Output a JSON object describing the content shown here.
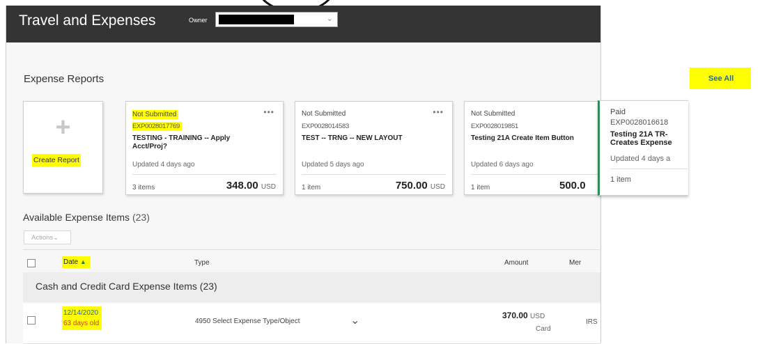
{
  "header": {
    "title": "Travel and Expenses",
    "owner_label": "Owner",
    "owner_chevron": "⌄"
  },
  "expense_reports": {
    "title": "Expense Reports",
    "see_all": "See All",
    "create_plus": "+",
    "create_label": "Create Report",
    "cards": [
      {
        "status": "Not Submitted",
        "number": "EXP0028017769",
        "name": "TESTING - TRAINING -- Apply Acct/Proj?",
        "updated": "Updated 4 days ago",
        "items": "3 items",
        "amount": "348.00",
        "currency": "USD",
        "menu": "•••"
      },
      {
        "status": "Not Submitted",
        "number": "EXP0028014583",
        "name": "TEST -- TRNG -- NEW LAYOUT",
        "updated": "Updated 5 days ago",
        "items": "1 item",
        "amount": "750.00",
        "currency": "USD",
        "menu": "•••"
      },
      {
        "status": "Not Submitted",
        "number": "EXP0028019851",
        "name": "Testing 21A Create Item Button",
        "updated": "Updated 6 days ago",
        "items": "1 item",
        "amount": "500.0"
      },
      {
        "status": "Paid",
        "number": "EXP0028016618",
        "name": "Testing 21A TR-Creates Expense",
        "updated": "Updated 4 days a",
        "items": "1 item"
      }
    ]
  },
  "available_items": {
    "title": "Available Expense Items",
    "count": "(23)",
    "actions_label": "Actions",
    "actions_chevron": "⌄",
    "columns": {
      "date": "Date",
      "sort_icon": "▲",
      "type": "Type",
      "amount": "Amount",
      "merchant": "Mer"
    },
    "group": {
      "label": "Cash and Credit Card Expense Items",
      "count": "(23)"
    },
    "rows": [
      {
        "date": "12/14/2020",
        "age": "63 days old",
        "type": "4950 Select Expense Type/Object",
        "expand_icon": "⌄",
        "amount": "370.00",
        "currency": "USD",
        "payment": "Card",
        "merchant": "IRS"
      }
    ]
  },
  "colors": {
    "header_bg": "#343434",
    "highlight": "#ffff00",
    "paid_accent": "#2e8b57",
    "link_blue": "#1f5fa8",
    "alert_red": "#d03b2b"
  }
}
